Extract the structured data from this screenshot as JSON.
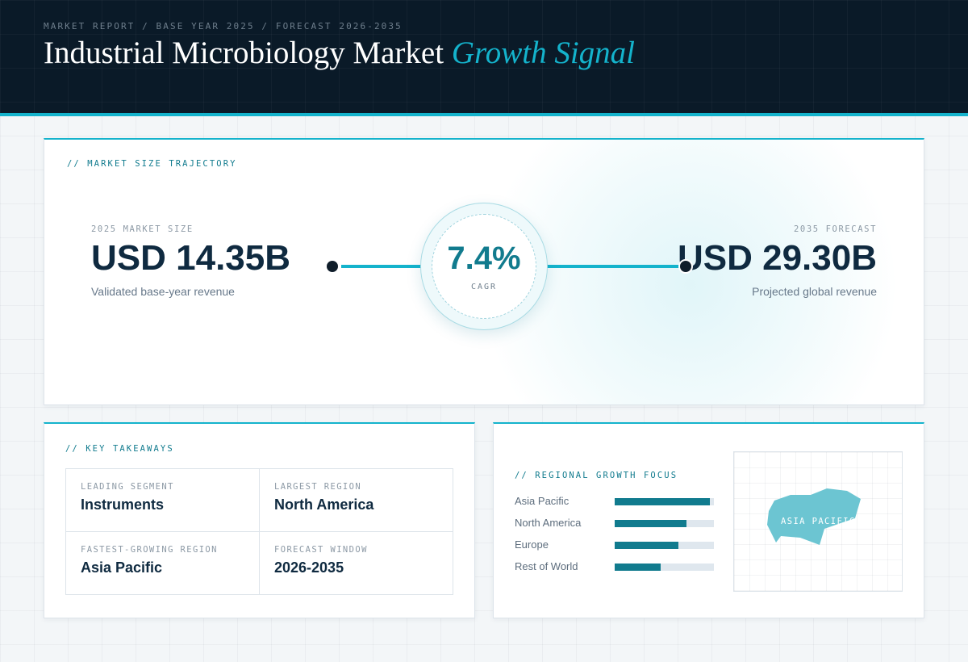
{
  "header": {
    "eyebrow": "MARKET REPORT / BASE YEAR 2025 / FORECAST 2026-2035",
    "title_main": "Industrial Microbiology Market",
    "title_accent": "Growth Signal"
  },
  "trajectory": {
    "section_label": "// MARKET SIZE TRAJECTORY",
    "left": {
      "eyebrow": "2025 MARKET SIZE",
      "value": "USD 14.35B",
      "sub": "Validated base-year revenue"
    },
    "right": {
      "eyebrow": "2035 FORECAST",
      "value": "USD 29.30B",
      "sub": "Projected global revenue"
    },
    "cagr": {
      "value": "7.4%",
      "label": "CAGR"
    }
  },
  "takeaways": {
    "section_label": "// KEY TAKEAWAYS",
    "items": [
      {
        "eyebrow": "LEADING SEGMENT",
        "value": "Instruments"
      },
      {
        "eyebrow": "LARGEST REGION",
        "value": "North America"
      },
      {
        "eyebrow": "FASTEST-GROWING REGION",
        "value": "Asia Pacific"
      },
      {
        "eyebrow": "FORECAST WINDOW",
        "value": "2026-2035"
      }
    ]
  },
  "regional": {
    "section_label": "// REGIONAL GROWTH FOCUS",
    "bars": [
      {
        "label": "Asia Pacific",
        "level": 0.96
      },
      {
        "label": "North America",
        "level": 0.72
      },
      {
        "label": "Europe",
        "level": 0.64
      },
      {
        "label": "Rest of World",
        "level": 0.46
      }
    ],
    "map_label": "ASIA PACIFIC"
  },
  "colors": {
    "accent": "#14b3cc",
    "bar_fill": "#117b8e",
    "header_bg": "#0a1a28",
    "text_dark": "#0f2a40"
  }
}
